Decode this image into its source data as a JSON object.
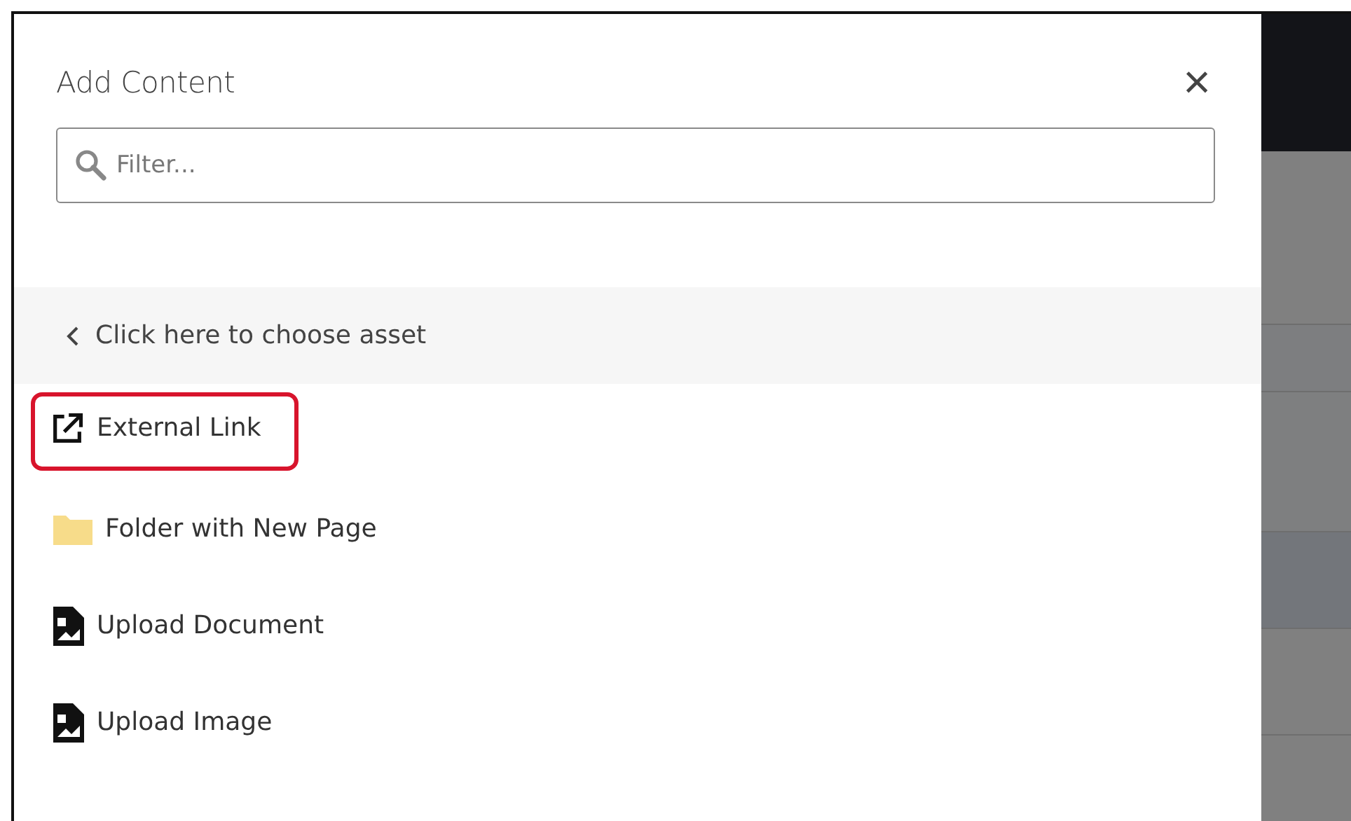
{
  "dialog": {
    "title": "Add Content",
    "close_label": "×"
  },
  "filter": {
    "placeholder": "Filter..."
  },
  "back_row": {
    "label": "Click here to choose asset"
  },
  "items": [
    {
      "kind": "external",
      "label": "External Link",
      "circled": true
    },
    {
      "kind": "folder",
      "label": "Folder with New Page",
      "circled": false
    },
    {
      "kind": "upload",
      "label": "Upload Document",
      "circled": false
    },
    {
      "kind": "upload",
      "label": "Upload Image",
      "circled": false
    }
  ]
}
